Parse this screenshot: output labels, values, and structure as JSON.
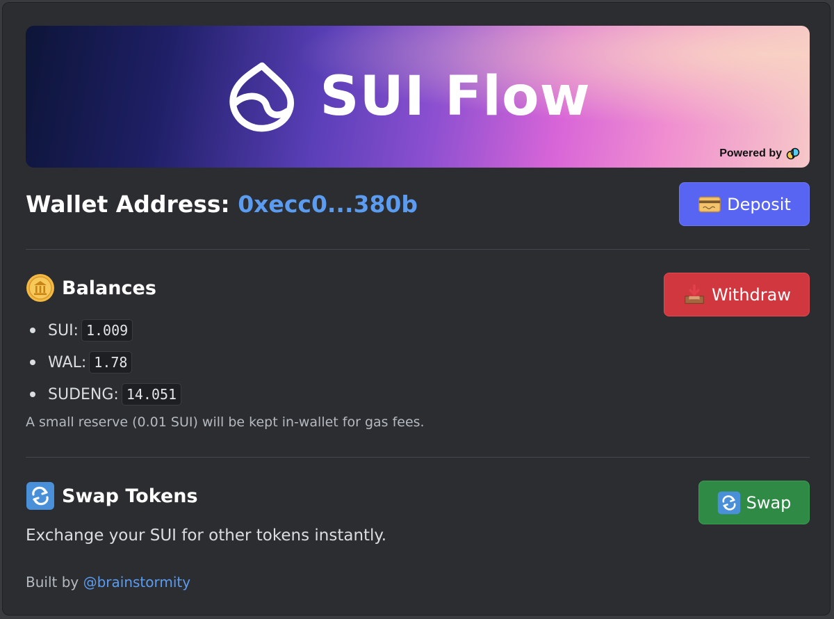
{
  "banner": {
    "title": "SUI Flow",
    "powered_by": "Powered by",
    "logo_icon": "sui-flow-leaf-icon",
    "powered_logo_icon": "partner-logo-icon"
  },
  "wallet": {
    "label": "Wallet Address:",
    "address": "0xecc0...380b"
  },
  "buttons": {
    "deposit": {
      "label": "Deposit",
      "icon": "credit-card-icon",
      "color": "#5865f2"
    },
    "withdraw": {
      "label": "Withdraw",
      "icon": "inbox-tray-icon",
      "color": "#d1373e"
    },
    "swap": {
      "label": "Swap",
      "icon": "repeat-arrows-icon",
      "color": "#2f8a46"
    }
  },
  "balances": {
    "title": "Balances",
    "icon": "coin-bank-icon",
    "items": [
      {
        "token": "SUI:",
        "amount": "1.009"
      },
      {
        "token": "WAL:",
        "amount": "1.78"
      },
      {
        "token": "SUDENG:",
        "amount": "14.051"
      }
    ],
    "note": "A small reserve (0.01 SUI) will be kept in-wallet for gas fees."
  },
  "swap_section": {
    "title": "Swap Tokens",
    "icon": "repeat-arrows-icon",
    "description": "Exchange your SUI for other tokens instantly."
  },
  "footer": {
    "prefix": "Built by",
    "link": "@brainstormity"
  },
  "colors": {
    "background": "#2b2d31",
    "link": "#5b9cf0"
  }
}
